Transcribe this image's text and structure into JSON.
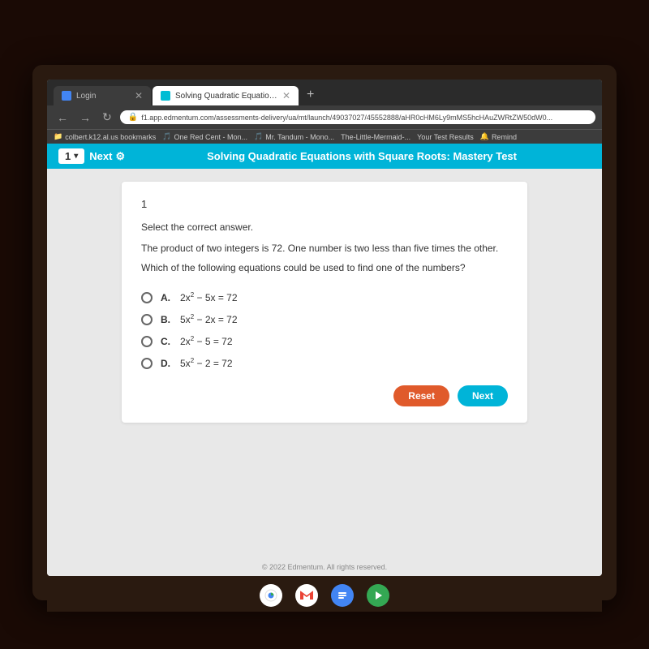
{
  "browser": {
    "tabs": [
      {
        "id": "login",
        "label": "Login",
        "active": false,
        "icon": "blue"
      },
      {
        "id": "edmentum",
        "label": "Solving Quadratic Equations wi",
        "active": true,
        "icon": "teal"
      }
    ],
    "address": "f1.app.edmentum.com/assessments-delivery/ua/mt/launch/49037027/45552888/aHR0cHM6Ly9mMS5hcHAuZWRtZW50dW0...",
    "bookmarks": [
      "colbert.k12.al.us bookmarks",
      "One Red Cent - Mon...",
      "Mr. Tandum - Mono...",
      "The-Little-Mermaid-...",
      "Your Test Results",
      "Remind"
    ]
  },
  "header": {
    "question_number": "1",
    "next_label": "Next",
    "settings_label": "⚙",
    "title": "Solving Quadratic Equations with Square Roots: Mastery Test"
  },
  "question": {
    "number": "1",
    "instruction": "Select the correct answer.",
    "text": "The product of two integers is 72. One number is two less than five times the other.",
    "subtext": "Which of the following equations could be used to find one of the numbers?",
    "options": [
      {
        "letter": "A.",
        "equation": "2x² − 5x = 72"
      },
      {
        "letter": "B.",
        "equation": "5x² − 2x = 72"
      },
      {
        "letter": "C.",
        "equation": "2x² − 5 = 72"
      },
      {
        "letter": "D.",
        "equation": "5x² − 2 = 72"
      }
    ]
  },
  "buttons": {
    "reset": "Reset",
    "next": "Next"
  },
  "footer": {
    "copyright": "© 2022 Edmentum. All rights reserved."
  }
}
